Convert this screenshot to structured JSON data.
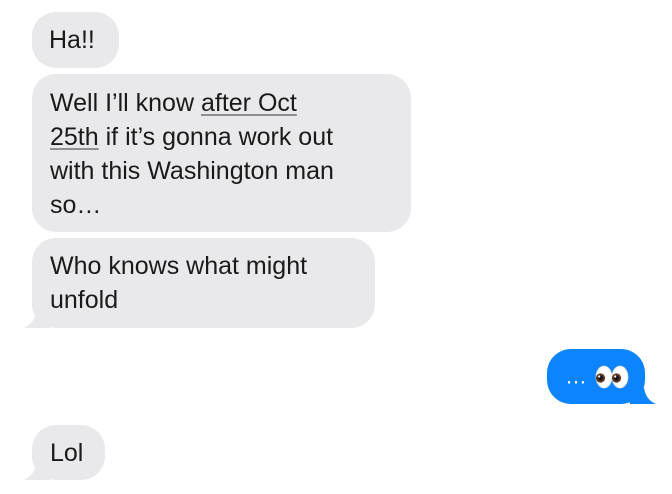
{
  "thread": {
    "messages": [
      {
        "direction": "incoming",
        "text": "Ha!!"
      },
      {
        "direction": "incoming",
        "text_before_link": "Well I’ll know ",
        "link_line1": "after Oct",
        "link_line2": "25th",
        "text_after_link_line2": " if it’s gonna work out",
        "text_line3": "with this Washington man",
        "text_line4": "so…"
      },
      {
        "direction": "incoming",
        "text_line1": "Who knows what might",
        "text_line2": "unfold"
      },
      {
        "direction": "outgoing",
        "text": "…",
        "emoji": "eyes-emoji"
      },
      {
        "direction": "incoming",
        "text": "Lol"
      }
    ]
  },
  "colors": {
    "incoming_bubble": "#e9e9eb",
    "outgoing_bubble": "#0b84fe",
    "incoming_text": "#1a1a1a",
    "outgoing_text": "#ffffff"
  }
}
